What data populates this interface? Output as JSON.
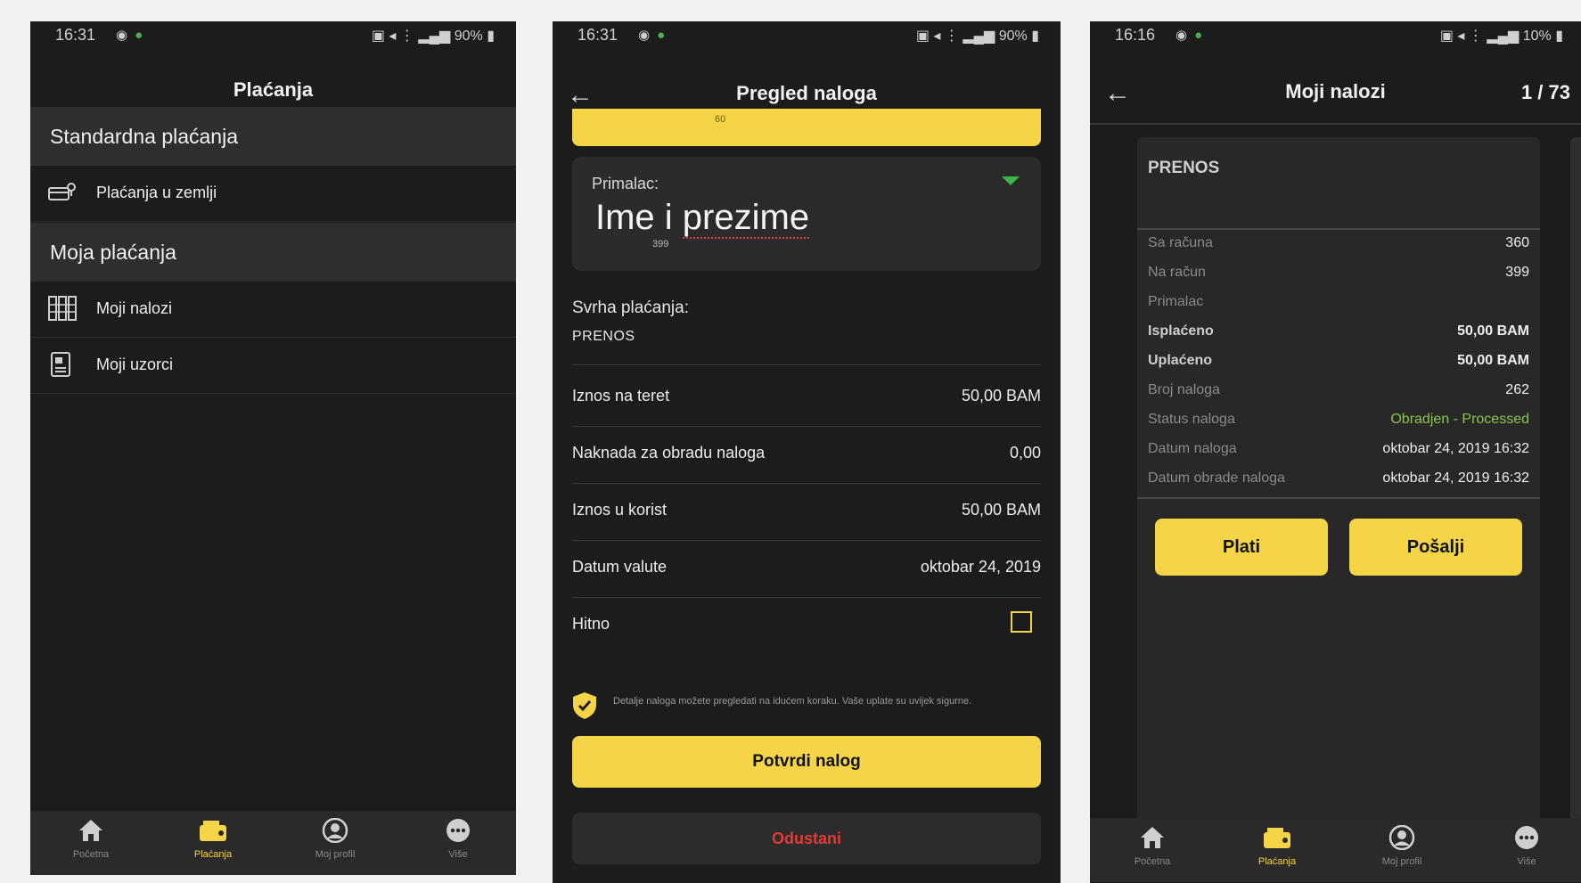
{
  "phone1": {
    "status": {
      "time": "16:31",
      "right": "90%"
    },
    "title": "Plaćanja",
    "sections": [
      {
        "heading": "Standardna plaćanja",
        "items": [
          "Plaćanja u zemlji"
        ]
      },
      {
        "heading": "Moja plaćanja",
        "items": [
          "Moji nalozi",
          "Moji uzorci"
        ]
      }
    ],
    "nav": [
      "Početna",
      "Plaćanja",
      "Moj profil",
      "Više"
    ]
  },
  "phone2": {
    "status": {
      "time": "16:31",
      "right": "90%"
    },
    "title": "Pregled naloga",
    "top_card_text": "60",
    "recipient": {
      "label": "Primalac:",
      "value_plain": "Ime i ",
      "value_underlined": "prezime",
      "sub": "399"
    },
    "purpose": {
      "label": "Svrha plaćanja:",
      "value": "PRENOS"
    },
    "rows": [
      {
        "label": "Iznos na teret",
        "value": "50,00 BAM"
      },
      {
        "label": "Naknada za obradu naloga",
        "value": "0,00"
      },
      {
        "label": "Iznos u korist",
        "value": "50,00 BAM"
      },
      {
        "label": "Datum valute",
        "value": "oktobar 24, 2019"
      }
    ],
    "urgent_label": "Hitno",
    "note": "Detalje naloga možete pregledati na idućem koraku. Vaše uplate su uvijek sigurne.",
    "confirm_button": "Potvrdi nalog",
    "cancel_button": "Odustani"
  },
  "phone3": {
    "status": {
      "time": "16:16",
      "right": "10%"
    },
    "title": "Moji nalozi",
    "pager": "1 / 73",
    "card_title": "PRENOS",
    "details": [
      {
        "label": "Sa računa",
        "value": "360",
        "bold": false
      },
      {
        "label": "Na račun",
        "value": "399",
        "bold": false
      },
      {
        "label": "Primalac",
        "value": "",
        "bold": false
      },
      {
        "label": "Isplaćeno",
        "value": "50,00 BAM",
        "bold": true
      },
      {
        "label": "Uplaćeno",
        "value": "50,00 BAM",
        "bold": true
      },
      {
        "label": "Broj naloga",
        "value": "262",
        "bold": false
      },
      {
        "label": "Status naloga",
        "value": "Obradjen - Processed",
        "bold": false
      },
      {
        "label": "Datum naloga",
        "value": "oktobar 24, 2019 16:32",
        "bold": false
      },
      {
        "label": "Datum obrade naloga",
        "value": "oktobar 24, 2019 16:32",
        "bold": false
      }
    ],
    "pay_button": "Plati",
    "send_button": "Pošalji",
    "nav": [
      "Početna",
      "Plaćanja",
      "Moj profil",
      "Više"
    ]
  },
  "colors": {
    "accent": "#f5d547",
    "background": "#1c1c1c",
    "status_ok": "#4caf50",
    "danger": "#e53935"
  }
}
